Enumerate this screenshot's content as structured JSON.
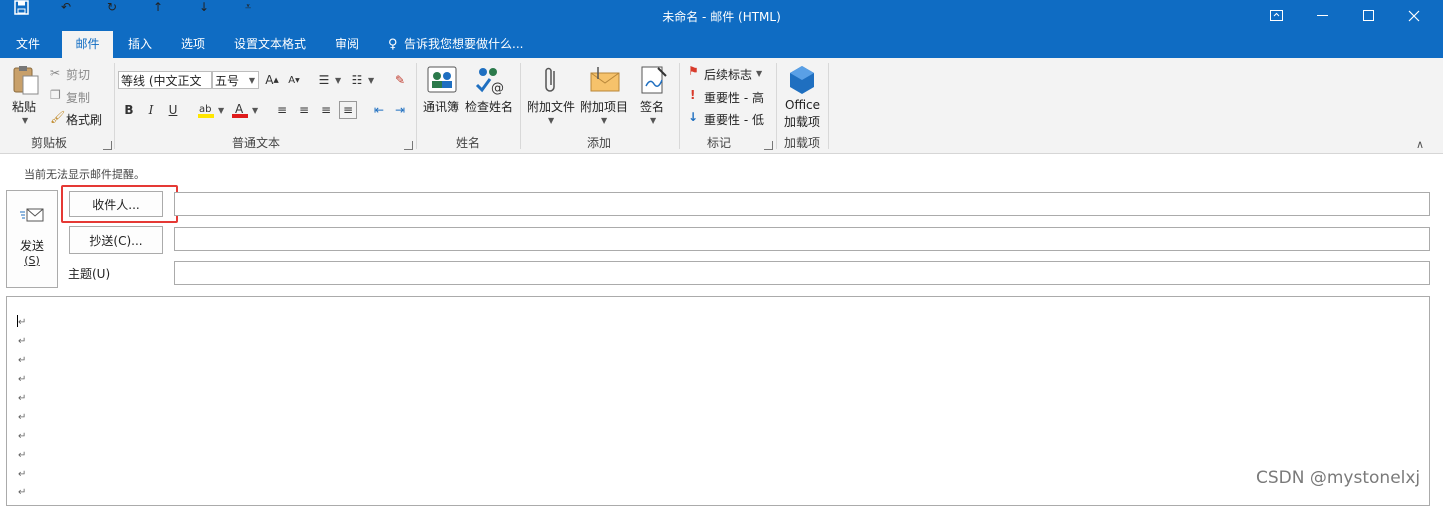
{
  "window": {
    "title": "未命名 - 邮件 (HTML)"
  },
  "tabs": [
    {
      "label": "文件"
    },
    {
      "label": "邮件"
    },
    {
      "label": "插入"
    },
    {
      "label": "选项"
    },
    {
      "label": "设置文本格式"
    },
    {
      "label": "审阅"
    },
    {
      "label": "告诉我您想要做什么..."
    }
  ],
  "ribbon": {
    "clipboard": {
      "paste": "粘贴",
      "cut": "剪切",
      "copy": "复制",
      "format_painter": "格式刷",
      "group": "剪贴板"
    },
    "basic_text": {
      "font": "等线 (中文正文",
      "size": "五号",
      "bold": "B",
      "italic": "I",
      "underline": "U",
      "group": "普通文本"
    },
    "names": {
      "address_book": "通讯簿",
      "check_names": "检查姓名",
      "group": "姓名"
    },
    "include": {
      "attach_file": "附加文件",
      "attach_item": "附加项目",
      "signature": "签名",
      "group": "添加"
    },
    "tags": {
      "follow_up": "后续标志",
      "high_importance": "重要性 - 高",
      "low_importance": "重要性 - 低",
      "group": "标记"
    },
    "addins": {
      "office_line1": "Office",
      "office_line2": "加载项",
      "group": "加载项"
    }
  },
  "compose": {
    "info_bar": "当前无法显示邮件提醒。",
    "send_line1": "发送",
    "send_line2": "(S)",
    "to_button": "收件人...",
    "cc_button": "抄送(C)...",
    "subject_label": "主题(U)",
    "to_value": "",
    "cc_value": "",
    "subject_value": ""
  },
  "watermark": "CSDN @mystonelxj",
  "colors": {
    "accent": "#0f6cc3",
    "highlight_box": "#e53935"
  }
}
